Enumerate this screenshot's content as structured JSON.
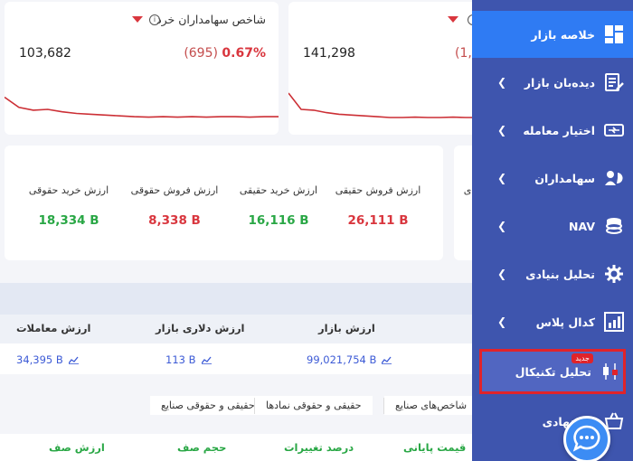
{
  "index_cards": [
    {
      "title": "شاخص سهامداران خرد",
      "value": "103,682",
      "change": "(695)",
      "percent": "0.67%"
    },
    {
      "value": "141,298",
      "change": "(1,2"
    }
  ],
  "value_cards": [
    {
      "label": "ارزش خرید حقوقی",
      "value": "18,334 B"
    },
    {
      "label": "ارزش فروش حقوقی",
      "value": "8,338 B"
    },
    {
      "label": "ارزش خرید حقیقی",
      "value": "16,116 B"
    },
    {
      "label": "ارزش فروش حقیقی",
      "value": "26,111 B"
    }
  ],
  "partial_right_label": "ی",
  "market_table": {
    "headers": [
      "ارزش معاملات",
      "ارزش دلاری بازار",
      "ارزش بازار"
    ],
    "values": [
      "34,395 B",
      "113 B",
      "99,021,754 B"
    ]
  },
  "tabs": [
    "حقیقی و حقوقی صنایع",
    "حقیقی و حقوقی نمادها",
    "شاخص‌های صنایع"
  ],
  "bottom_headers": [
    "ارزش صف",
    "حجم صف",
    "درصد تغییرات",
    "قیمت پایانی"
  ],
  "sidebar": {
    "items": [
      {
        "label": "خلاصه بازار",
        "icon": "dashboard-icon"
      },
      {
        "label": "دیده‌بان بازار",
        "icon": "watchlist-icon"
      },
      {
        "label": "اختیار معامله",
        "icon": "options-icon"
      },
      {
        "label": "سهامداران",
        "icon": "shareholders-icon"
      },
      {
        "label": "NAV",
        "icon": "coins-icon"
      },
      {
        "label": "تحلیل بنیادی",
        "icon": "gear-icon"
      },
      {
        "label": "کدال پلاس",
        "icon": "bar-chart-icon"
      },
      {
        "label": "تحلیل تکنیکال",
        "icon": "candlestick-icon",
        "badge": "جدید"
      },
      {
        "label": "پیشنهادی",
        "icon": "basket-icon"
      }
    ]
  },
  "colors": {
    "sidebar_bg": "#3e55ae",
    "sidebar_active": "#2f7bf3",
    "negative": "#d9363e",
    "positive": "#29a745",
    "link_blue": "#3d5bd6"
  },
  "sparkline_1": [
    0.3,
    0.55,
    0.62,
    0.6,
    0.66,
    0.7,
    0.72,
    0.74,
    0.76,
    0.78,
    0.79,
    0.78,
    0.79,
    0.78,
    0.79,
    0.78,
    0.78,
    0.79,
    0.78,
    0.78
  ],
  "sparkline_2": [
    0.2,
    0.6,
    0.62,
    0.68,
    0.72,
    0.74,
    0.76,
    0.78,
    0.8,
    0.8,
    0.79,
    0.8,
    0.8,
    0.79,
    0.8,
    0.8
  ]
}
